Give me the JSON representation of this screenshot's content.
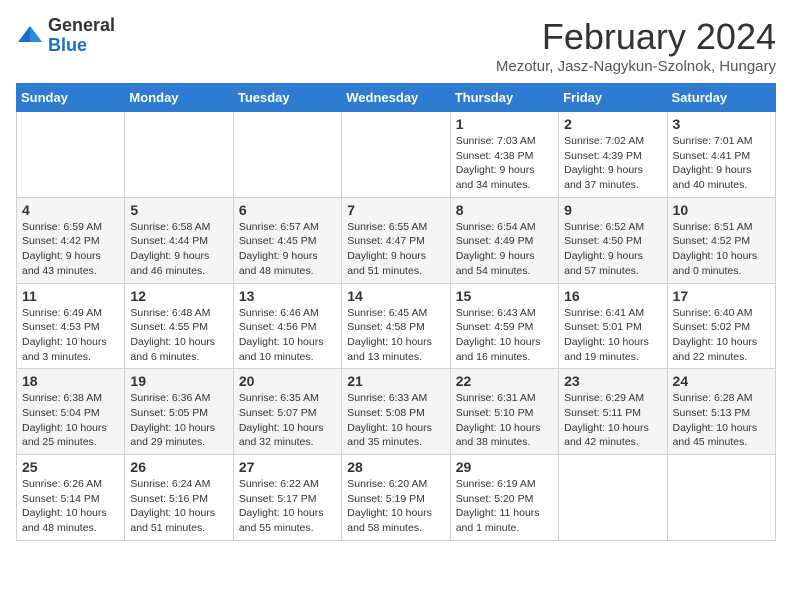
{
  "logo": {
    "general": "General",
    "blue": "Blue"
  },
  "header": {
    "month_title": "February 2024",
    "subtitle": "Mezotur, Jasz-Nagykun-Szolnok, Hungary"
  },
  "days_of_week": [
    "Sunday",
    "Monday",
    "Tuesday",
    "Wednesday",
    "Thursday",
    "Friday",
    "Saturday"
  ],
  "weeks": [
    [
      {
        "day": "",
        "info": ""
      },
      {
        "day": "",
        "info": ""
      },
      {
        "day": "",
        "info": ""
      },
      {
        "day": "",
        "info": ""
      },
      {
        "day": "1",
        "info": "Sunrise: 7:03 AM\nSunset: 4:38 PM\nDaylight: 9 hours\nand 34 minutes."
      },
      {
        "day": "2",
        "info": "Sunrise: 7:02 AM\nSunset: 4:39 PM\nDaylight: 9 hours\nand 37 minutes."
      },
      {
        "day": "3",
        "info": "Sunrise: 7:01 AM\nSunset: 4:41 PM\nDaylight: 9 hours\nand 40 minutes."
      }
    ],
    [
      {
        "day": "4",
        "info": "Sunrise: 6:59 AM\nSunset: 4:42 PM\nDaylight: 9 hours\nand 43 minutes."
      },
      {
        "day": "5",
        "info": "Sunrise: 6:58 AM\nSunset: 4:44 PM\nDaylight: 9 hours\nand 46 minutes."
      },
      {
        "day": "6",
        "info": "Sunrise: 6:57 AM\nSunset: 4:45 PM\nDaylight: 9 hours\nand 48 minutes."
      },
      {
        "day": "7",
        "info": "Sunrise: 6:55 AM\nSunset: 4:47 PM\nDaylight: 9 hours\nand 51 minutes."
      },
      {
        "day": "8",
        "info": "Sunrise: 6:54 AM\nSunset: 4:49 PM\nDaylight: 9 hours\nand 54 minutes."
      },
      {
        "day": "9",
        "info": "Sunrise: 6:52 AM\nSunset: 4:50 PM\nDaylight: 9 hours\nand 57 minutes."
      },
      {
        "day": "10",
        "info": "Sunrise: 6:51 AM\nSunset: 4:52 PM\nDaylight: 10 hours\nand 0 minutes."
      }
    ],
    [
      {
        "day": "11",
        "info": "Sunrise: 6:49 AM\nSunset: 4:53 PM\nDaylight: 10 hours\nand 3 minutes."
      },
      {
        "day": "12",
        "info": "Sunrise: 6:48 AM\nSunset: 4:55 PM\nDaylight: 10 hours\nand 6 minutes."
      },
      {
        "day": "13",
        "info": "Sunrise: 6:46 AM\nSunset: 4:56 PM\nDaylight: 10 hours\nand 10 minutes."
      },
      {
        "day": "14",
        "info": "Sunrise: 6:45 AM\nSunset: 4:58 PM\nDaylight: 10 hours\nand 13 minutes."
      },
      {
        "day": "15",
        "info": "Sunrise: 6:43 AM\nSunset: 4:59 PM\nDaylight: 10 hours\nand 16 minutes."
      },
      {
        "day": "16",
        "info": "Sunrise: 6:41 AM\nSunset: 5:01 PM\nDaylight: 10 hours\nand 19 minutes."
      },
      {
        "day": "17",
        "info": "Sunrise: 6:40 AM\nSunset: 5:02 PM\nDaylight: 10 hours\nand 22 minutes."
      }
    ],
    [
      {
        "day": "18",
        "info": "Sunrise: 6:38 AM\nSunset: 5:04 PM\nDaylight: 10 hours\nand 25 minutes."
      },
      {
        "day": "19",
        "info": "Sunrise: 6:36 AM\nSunset: 5:05 PM\nDaylight: 10 hours\nand 29 minutes."
      },
      {
        "day": "20",
        "info": "Sunrise: 6:35 AM\nSunset: 5:07 PM\nDaylight: 10 hours\nand 32 minutes."
      },
      {
        "day": "21",
        "info": "Sunrise: 6:33 AM\nSunset: 5:08 PM\nDaylight: 10 hours\nand 35 minutes."
      },
      {
        "day": "22",
        "info": "Sunrise: 6:31 AM\nSunset: 5:10 PM\nDaylight: 10 hours\nand 38 minutes."
      },
      {
        "day": "23",
        "info": "Sunrise: 6:29 AM\nSunset: 5:11 PM\nDaylight: 10 hours\nand 42 minutes."
      },
      {
        "day": "24",
        "info": "Sunrise: 6:28 AM\nSunset: 5:13 PM\nDaylight: 10 hours\nand 45 minutes."
      }
    ],
    [
      {
        "day": "25",
        "info": "Sunrise: 6:26 AM\nSunset: 5:14 PM\nDaylight: 10 hours\nand 48 minutes."
      },
      {
        "day": "26",
        "info": "Sunrise: 6:24 AM\nSunset: 5:16 PM\nDaylight: 10 hours\nand 51 minutes."
      },
      {
        "day": "27",
        "info": "Sunrise: 6:22 AM\nSunset: 5:17 PM\nDaylight: 10 hours\nand 55 minutes."
      },
      {
        "day": "28",
        "info": "Sunrise: 6:20 AM\nSunset: 5:19 PM\nDaylight: 10 hours\nand 58 minutes."
      },
      {
        "day": "29",
        "info": "Sunrise: 6:19 AM\nSunset: 5:20 PM\nDaylight: 11 hours\nand 1 minute."
      },
      {
        "day": "",
        "info": ""
      },
      {
        "day": "",
        "info": ""
      }
    ]
  ]
}
